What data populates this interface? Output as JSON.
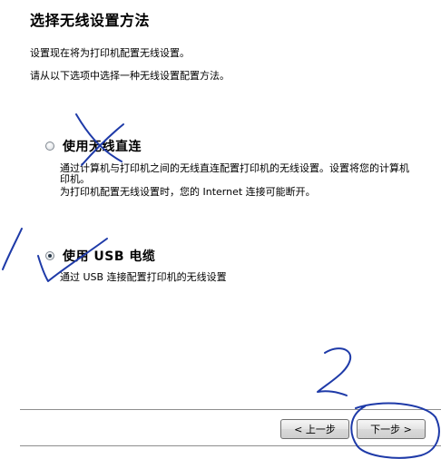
{
  "window": {
    "title": "选择无线设置方法"
  },
  "intro": {
    "line1": "设置现在将为打印机配置无线设置。",
    "line2": "请从以下选项中选择一种无线设置配置方法。"
  },
  "options": [
    {
      "label": "使用无线直连",
      "selected": false,
      "desc_line1": "通过计算机与打印机之间的无线直连配置打印机的无线设置。设置将您的计算机",
      "desc_line2": "印机。",
      "desc_line3": "为打印机配置无线设置时，您的 Internet 连接可能断开。"
    },
    {
      "label": "使用 USB 电缆",
      "selected": true,
      "desc_line1": "通过 USB 连接配置打印机的无线设置"
    }
  ],
  "buttons": {
    "back_label": "< 上一步",
    "next_label": "下一步 >"
  },
  "annotations": {
    "ink_color": "#1e3aa8",
    "mark_1": "1",
    "mark_2": "2"
  }
}
